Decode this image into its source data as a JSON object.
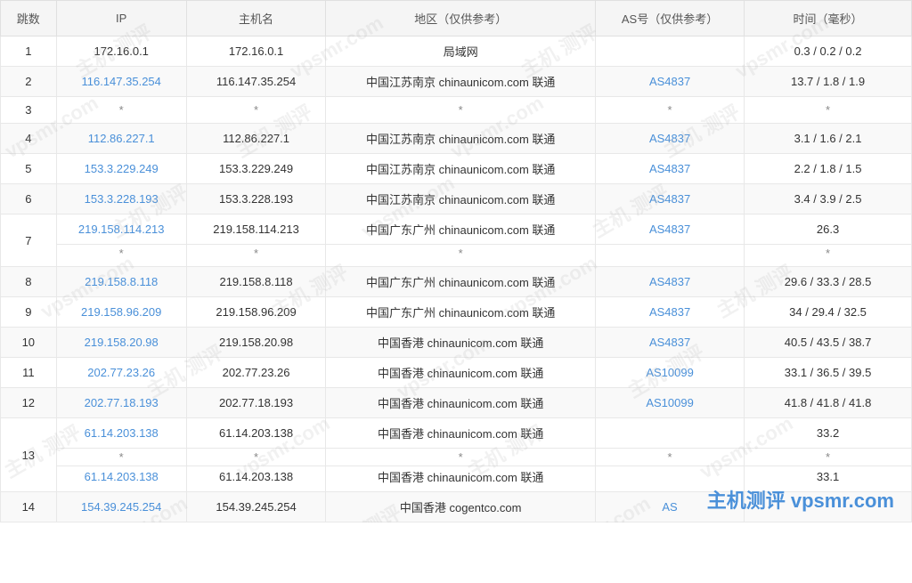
{
  "table": {
    "headers": [
      "跳数",
      "IP",
      "主机名",
      "地区（仅供参考）",
      "AS号（仅供参考）",
      "时间（毫秒）"
    ],
    "rows": [
      {
        "hop": "1",
        "ip": "172.16.0.1",
        "ip_link": false,
        "hostname": "172.16.0.1",
        "region": "局域网",
        "as": "",
        "time": "0.3 / 0.2 / 0.2",
        "sub": []
      },
      {
        "hop": "2",
        "ip": "116.147.35.254",
        "ip_link": true,
        "hostname": "116.147.35.254",
        "region": "中国江苏南京 chinaunicom.com 联通",
        "as": "AS4837",
        "as_link": true,
        "time": "13.7 / 1.8 / 1.9",
        "sub": []
      },
      {
        "hop": "3",
        "ip": "*",
        "ip_link": false,
        "hostname": "*",
        "region": "*",
        "as": "*",
        "as_link": false,
        "time": "*",
        "sub": []
      },
      {
        "hop": "4",
        "ip": "112.86.227.1",
        "ip_link": true,
        "hostname": "112.86.227.1",
        "region": "中国江苏南京 chinaunicom.com 联通",
        "as": "AS4837",
        "as_link": true,
        "time": "3.1 / 1.6 / 2.1",
        "sub": []
      },
      {
        "hop": "5",
        "ip": "153.3.229.249",
        "ip_link": true,
        "hostname": "153.3.229.249",
        "region": "中国江苏南京 chinaunicom.com 联通",
        "as": "AS4837",
        "as_link": true,
        "time": "2.2 / 1.8 / 1.5",
        "sub": []
      },
      {
        "hop": "6",
        "ip": "153.3.228.193",
        "ip_link": true,
        "hostname": "153.3.228.193",
        "region": "中国江苏南京 chinaunicom.com 联通",
        "as": "AS4837",
        "as_link": true,
        "time": "3.4 / 3.9 / 2.5",
        "sub": []
      },
      {
        "hop": "7",
        "ip": "219.158.114.213",
        "ip_link": true,
        "hostname": "219.158.114.213",
        "region": "中国广东广州 chinaunicom.com 联通",
        "as": "AS4837",
        "as_link": true,
        "time": "26.3",
        "sub": [
          {
            "ip": "*",
            "ip_link": false,
            "hostname": "*",
            "region": "*",
            "as": "",
            "time": "*"
          }
        ]
      },
      {
        "hop": "8",
        "ip": "219.158.8.118",
        "ip_link": true,
        "hostname": "219.158.8.118",
        "region": "中国广东广州 chinaunicom.com 联通",
        "as": "AS4837",
        "as_link": true,
        "time": "29.6 / 33.3 / 28.5",
        "sub": []
      },
      {
        "hop": "9",
        "ip": "219.158.96.209",
        "ip_link": true,
        "hostname": "219.158.96.209",
        "region": "中国广东广州 chinaunicom.com 联通",
        "as": "AS4837",
        "as_link": true,
        "time": "34 / 29.4 / 32.5",
        "sub": []
      },
      {
        "hop": "10",
        "ip": "219.158.20.98",
        "ip_link": true,
        "hostname": "219.158.20.98",
        "region": "中国香港 chinaunicom.com 联通",
        "as": "AS4837",
        "as_link": true,
        "time": "40.5 / 43.5 / 38.7",
        "sub": []
      },
      {
        "hop": "11",
        "ip": "202.77.23.26",
        "ip_link": true,
        "hostname": "202.77.23.26",
        "region": "中国香港 chinaunicom.com 联通",
        "as": "AS10099",
        "as_link": true,
        "time": "33.1 / 36.5 / 39.5",
        "sub": []
      },
      {
        "hop": "12",
        "ip": "202.77.18.193",
        "ip_link": true,
        "hostname": "202.77.18.193",
        "region": "中国香港 chinaunicom.com 联通",
        "as": "AS10099",
        "as_link": true,
        "time": "41.8 / 41.8 / 41.8",
        "sub": []
      },
      {
        "hop": "13",
        "ip": "61.14.203.138",
        "ip_link": true,
        "hostname": "61.14.203.138",
        "region": "中国香港 chinaunicom.com 联通",
        "as": "",
        "as_link": false,
        "time": "33.2",
        "sub": [
          {
            "ip": "*",
            "ip_link": false,
            "hostname": "*",
            "region": "*",
            "as": "*",
            "time": "*"
          },
          {
            "ip": "61.14.203.138",
            "ip_link": true,
            "hostname": "61.14.203.138",
            "region": "中国香港 chinaunicom.com 联通",
            "as": "",
            "time": "33.1",
            "is_last": true
          }
        ]
      },
      {
        "hop": "14",
        "ip": "154.39.245.254",
        "ip_link": true,
        "hostname": "154.39.245.254",
        "region": "中国香港 cogentco.com",
        "as": "AS",
        "as_link": true,
        "time": "",
        "sub": []
      }
    ],
    "brand": "主机测评 vpsmr.com"
  }
}
